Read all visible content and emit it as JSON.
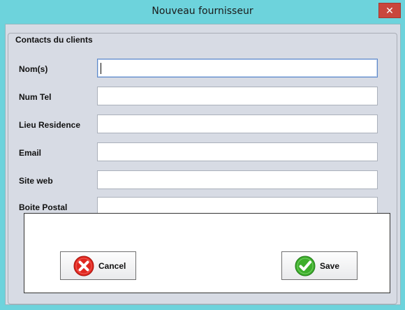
{
  "window": {
    "title": "Nouveau fournisseur",
    "close_glyph": "✕"
  },
  "group": {
    "label": "Contacts du clients"
  },
  "fields": [
    {
      "label": "Nom(s)",
      "value": ""
    },
    {
      "label": "Num Tel",
      "value": ""
    },
    {
      "label": "Lieu Residence",
      "value": ""
    },
    {
      "label": "Email",
      "value": ""
    },
    {
      "label": "Site web",
      "value": ""
    },
    {
      "label": "Boite Postal",
      "value": ""
    }
  ],
  "buttons": {
    "cancel_label": "Cancel",
    "cancel_icon": "cancel-icon",
    "save_label": "Save",
    "save_icon": "checkmark-icon"
  },
  "colors": {
    "cancel_icon": "#e0271f",
    "save_icon": "#3dae2b"
  }
}
